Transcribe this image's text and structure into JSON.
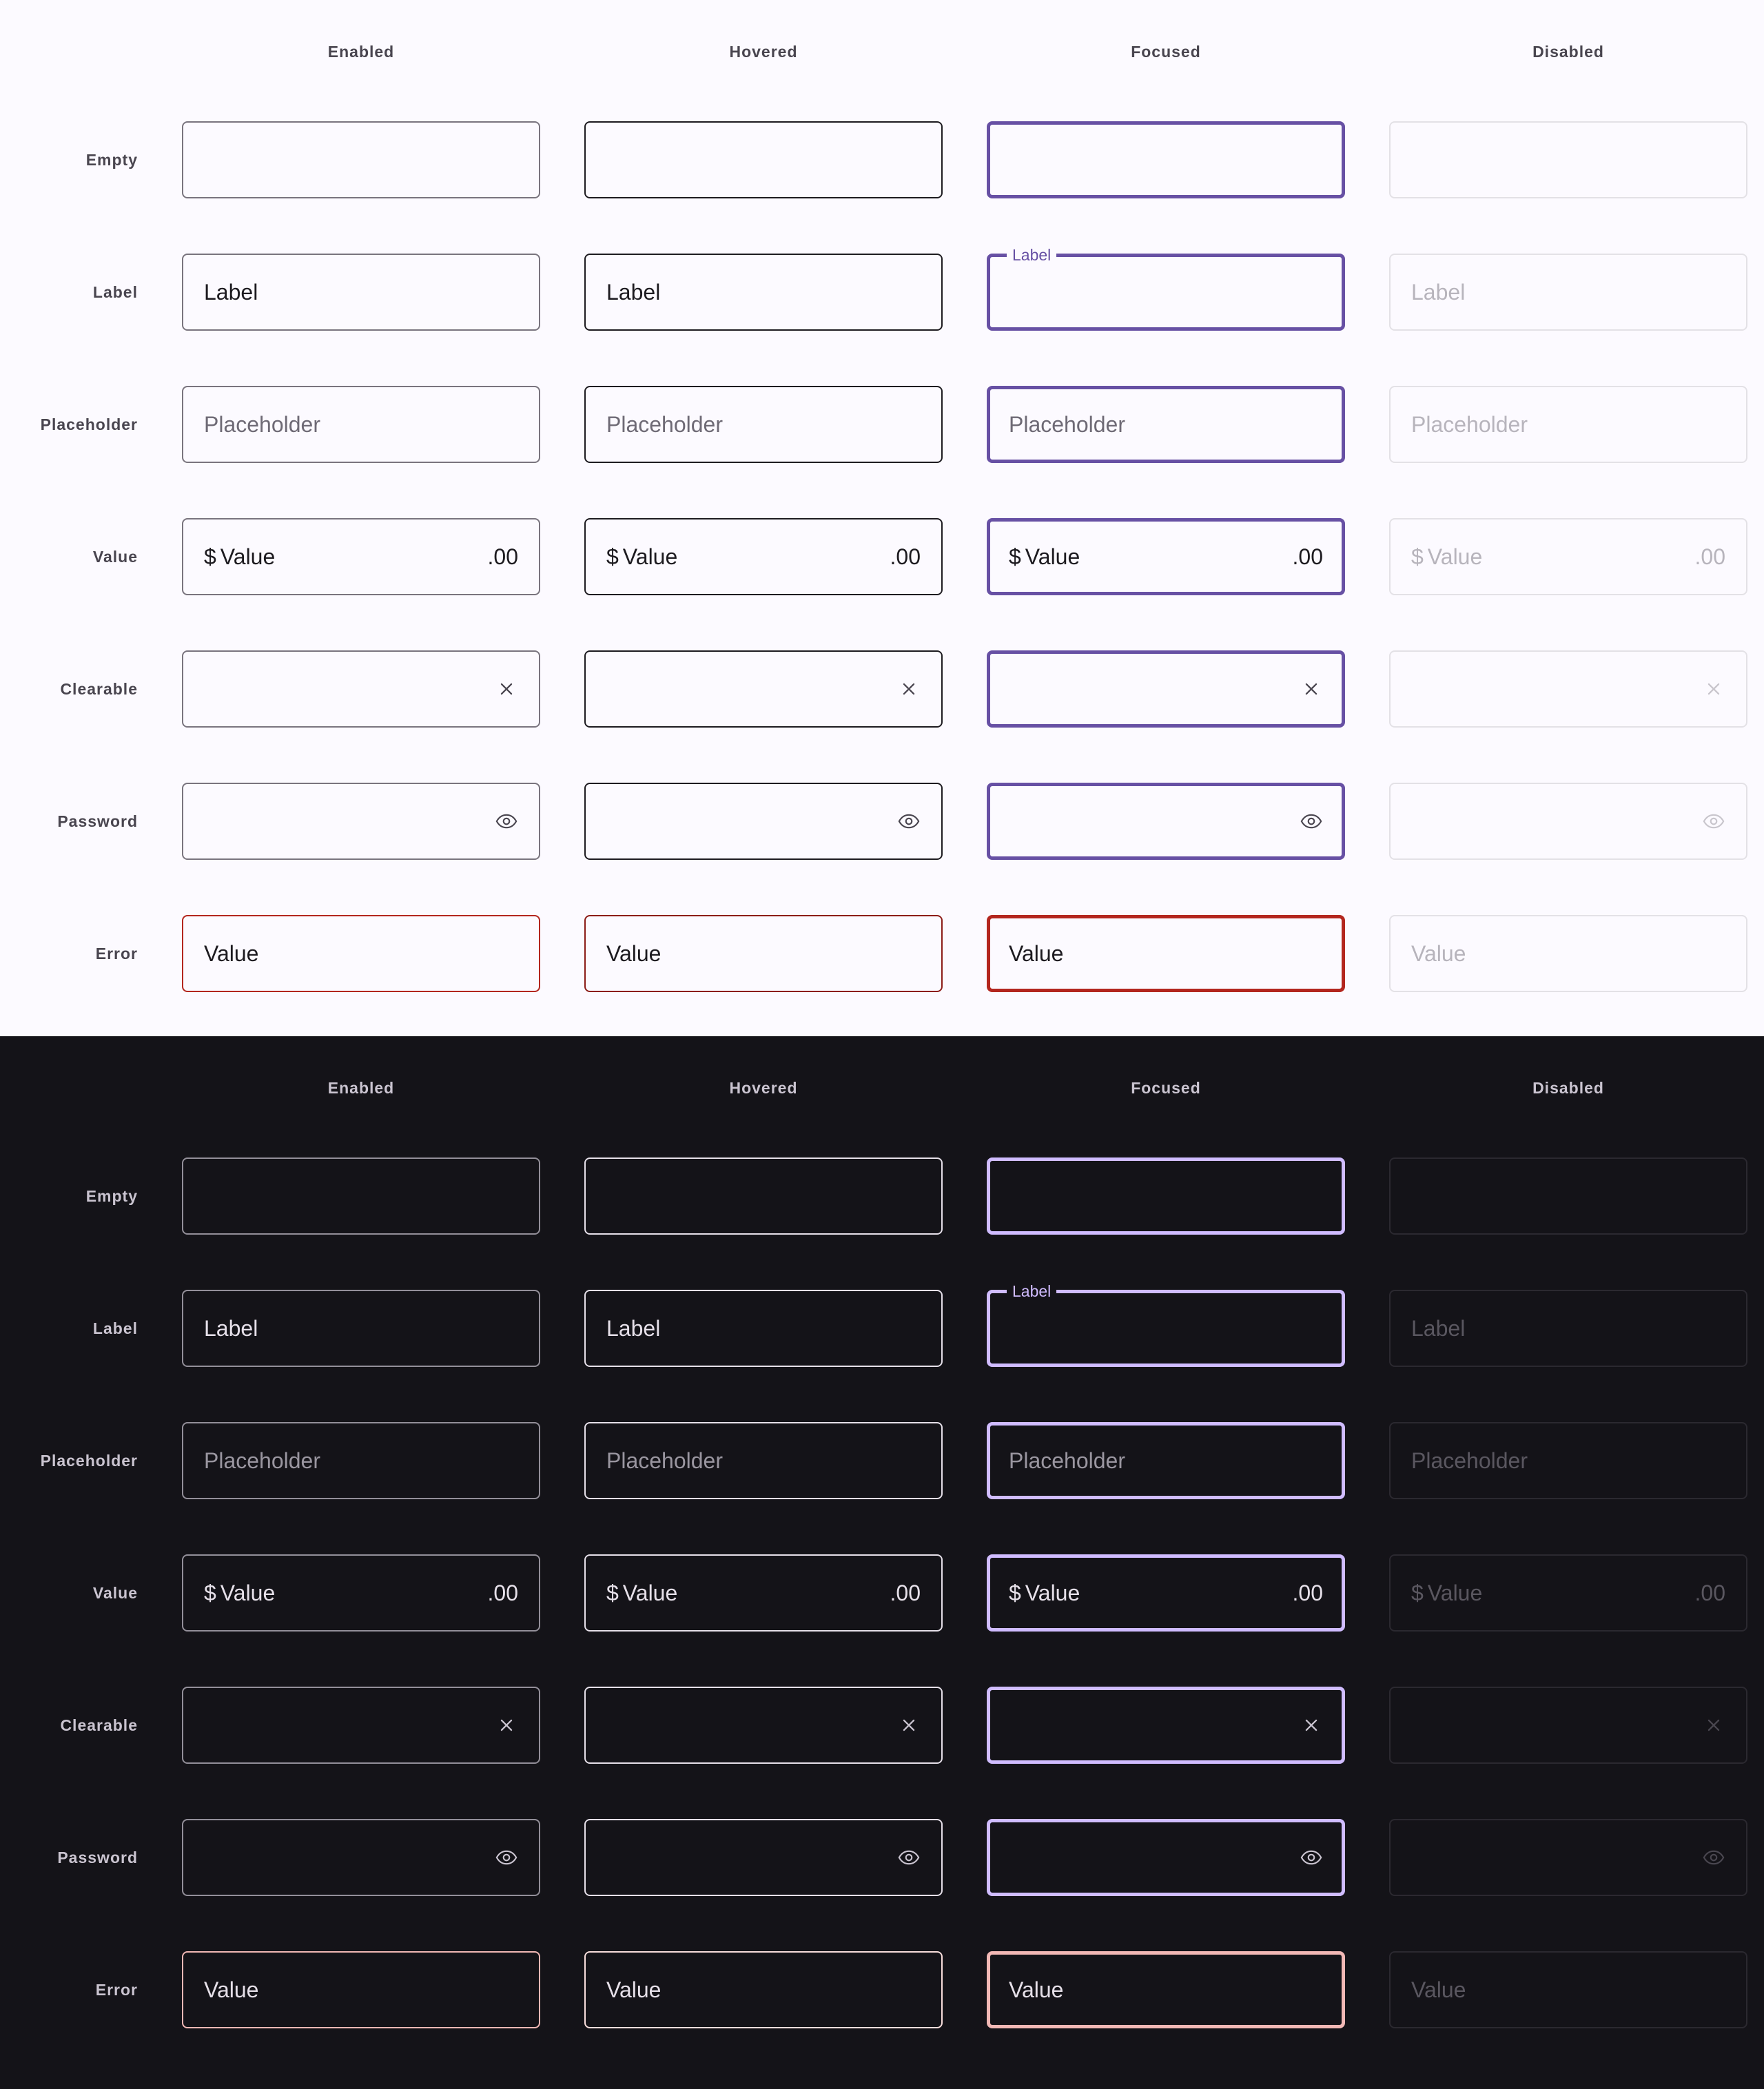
{
  "columns": {
    "enabled": "Enabled",
    "hovered": "Hovered",
    "focused": "Focused",
    "disabled": "Disabled"
  },
  "rows": {
    "empty": "Empty",
    "label": "Label",
    "placeholder": "Placeholder",
    "value": "Value",
    "clearable": "Clearable",
    "password": "Password",
    "error": "Error"
  },
  "field_text": {
    "label": "Label",
    "placeholder": "Placeholder",
    "prefix": "$",
    "value": "Value",
    "suffix": ".00",
    "error_value": "Value"
  },
  "icons": {
    "clear": "close-icon",
    "password": "eye-icon"
  },
  "colors": {
    "light_bg": "#fcfaff",
    "dark_bg": "#141318",
    "light_focus": "#6750a4",
    "dark_focus": "#d0bcff",
    "light_error": "#b3261e",
    "dark_error": "#f2b8b5"
  }
}
